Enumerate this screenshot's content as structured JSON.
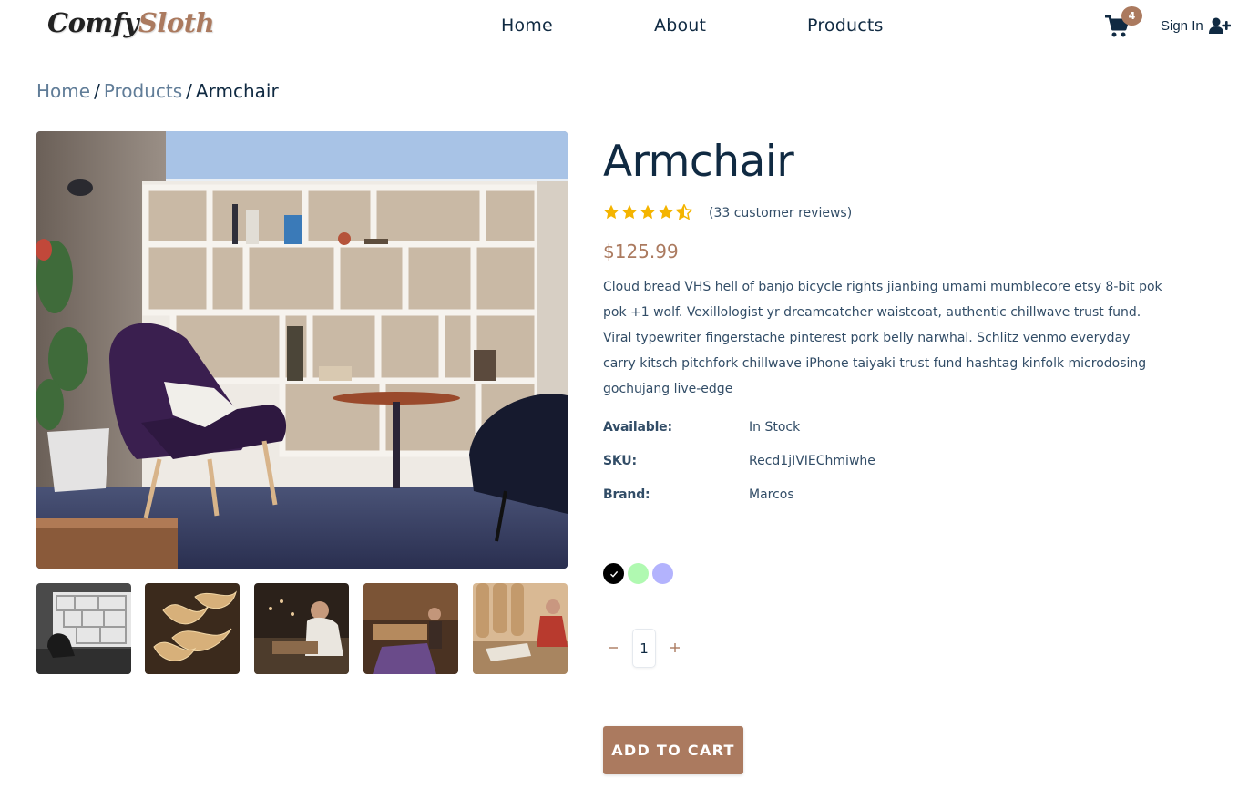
{
  "logo": {
    "part1": "Comfy",
    "part2": "Sloth"
  },
  "nav": {
    "links": [
      "Home",
      "About",
      "Products"
    ],
    "cart_count": "4",
    "signin_label": "Sign In"
  },
  "breadcrumb": {
    "home": "Home",
    "products": "Products",
    "current": "Armchair",
    "separator": "/"
  },
  "product": {
    "title": "Armchair",
    "rating": 4.5,
    "rating_max": 5,
    "reviews": "(33 customer reviews)",
    "price": "$125.99",
    "description": "Cloud bread VHS hell of banjo bicycle rights jianbing umami mumblecore etsy 8-bit pok pok +1 wolf. Vexillologist yr dreamcatcher waistcoat, authentic chillwave trust fund. Viral typewriter fingerstache pinterest pork belly narwhal. Schlitz venmo everyday carry kitsch pitchfork chillwave iPhone taiyaki trust fund hashtag kinfolk microdosing gochujang live-edge",
    "info": [
      {
        "label": "Available:",
        "value": "In Stock"
      },
      {
        "label": "SKU:",
        "value": "Recd1jIVIEChmiwhe"
      },
      {
        "label": "Brand:",
        "value": "Marcos"
      }
    ],
    "colors": [
      "#000000",
      "#7bf57d",
      "#8180fb"
    ],
    "selected_color": 0,
    "quantity": "1",
    "add_to_cart_label": "ADD TO CART"
  },
  "theme": {
    "accent": "#ab7a5f",
    "star": "#f4b400",
    "text_dark": "#102a42"
  }
}
